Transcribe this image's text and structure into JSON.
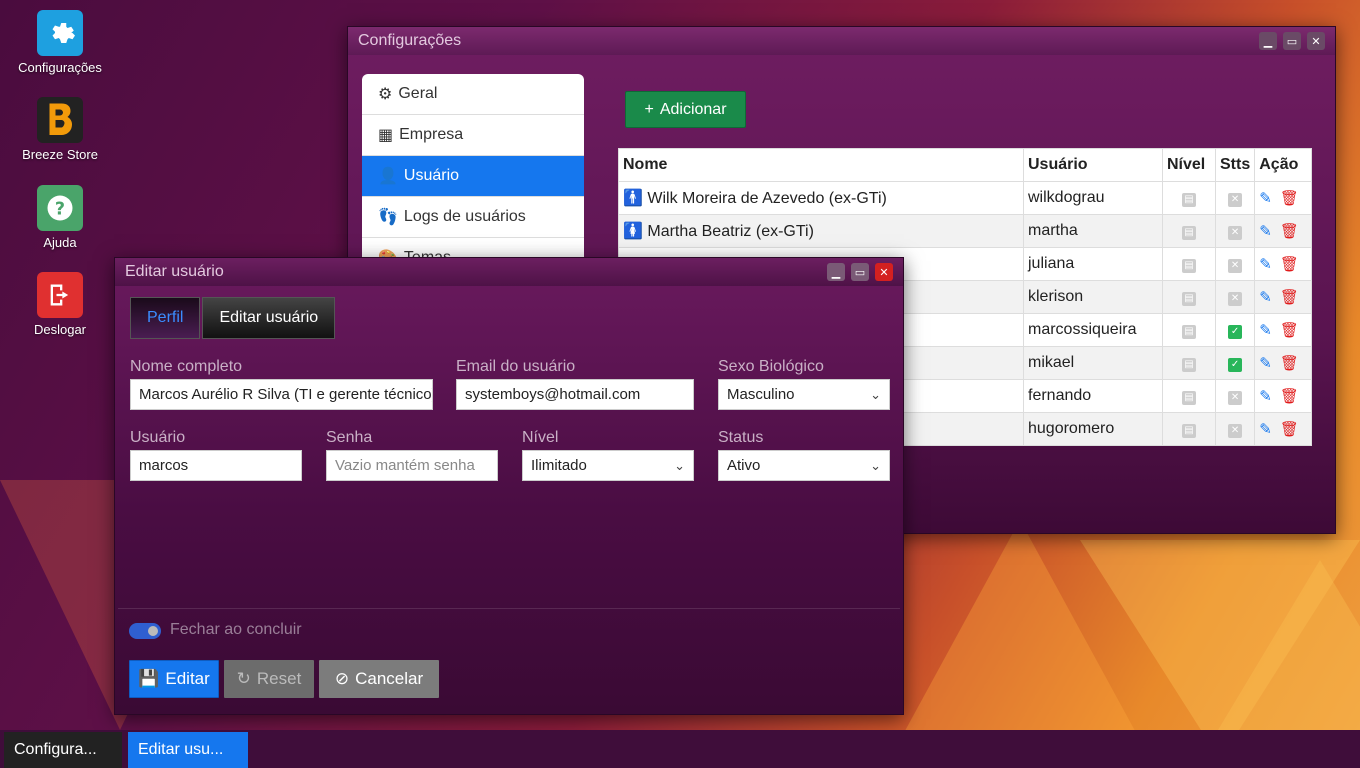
{
  "desktop": {
    "icons": [
      {
        "label": "Configurações",
        "icon": "gear-icon",
        "color": "#1ea0e0"
      },
      {
        "label": "Breeze Store",
        "icon": "store-icon",
        "color": "#f29a0a"
      },
      {
        "label": "Ajuda",
        "icon": "help-icon",
        "color": "#4aa46a"
      },
      {
        "label": "Deslogar",
        "icon": "logout-icon",
        "color": "#e03030"
      }
    ]
  },
  "config_window": {
    "title": "Configurações",
    "sidebar": [
      {
        "label": "Geral",
        "icon": "gear-icon"
      },
      {
        "label": "Empresa",
        "icon": "building-icon"
      },
      {
        "label": "Usuário",
        "icon": "user-icon"
      },
      {
        "label": "Logs de usuários",
        "icon": "footprints-icon"
      },
      {
        "label": "Temas",
        "icon": "palette-icon"
      }
    ],
    "add_button": "Adicionar",
    "table": {
      "headers": [
        "Nome",
        "Usuário",
        "Nível",
        "Stts",
        "Ação"
      ],
      "rows": [
        {
          "name": "Wilk Moreira de Azevedo (ex-GTi)",
          "user": "wilkdograu",
          "status": "off"
        },
        {
          "name": "Martha Beatriz (ex-GTi)",
          "user": "martha",
          "status": "off"
        },
        {
          "name": "",
          "user": "juliana",
          "status": "off"
        },
        {
          "name": "",
          "user": "klerison",
          "status": "off"
        },
        {
          "name": "",
          "user": "marcossiqueira",
          "status": "on"
        },
        {
          "name": "",
          "user": "mikael",
          "status": "on"
        },
        {
          "name": "",
          "user": "fernando",
          "status": "off"
        },
        {
          "name": "",
          "user": "hugoromero",
          "status": "off"
        }
      ]
    }
  },
  "edit_window": {
    "title": "Editar usuário",
    "tabs": [
      "Perfil",
      "Editar usuário"
    ],
    "fields": {
      "nome_label": "Nome completo",
      "nome_value": "Marcos Aurélio R Silva (TI e gerente técnico)",
      "email_label": "Email do usuário",
      "email_value": "systemboys@hotmail.com",
      "sexo_label": "Sexo Biológico",
      "sexo_value": "Masculino",
      "usuario_label": "Usuário",
      "usuario_value": "marcos",
      "senha_label": "Senha",
      "senha_placeholder": "Vazio mantém senha",
      "nivel_label": "Nível",
      "nivel_value": "Ilimitado",
      "status_label": "Status",
      "status_value": "Ativo"
    },
    "toggle_label": "Fechar ao concluir",
    "buttons": {
      "edit": "Editar",
      "reset": "Reset",
      "cancel": "Cancelar"
    }
  },
  "taskbar": {
    "items": [
      "Configura...",
      "Editar usu..."
    ]
  },
  "colors": {
    "accent": "#1577ee",
    "add_button": "#1a8a4a",
    "status_on": "#28b65a",
    "danger": "#e01b1b"
  }
}
